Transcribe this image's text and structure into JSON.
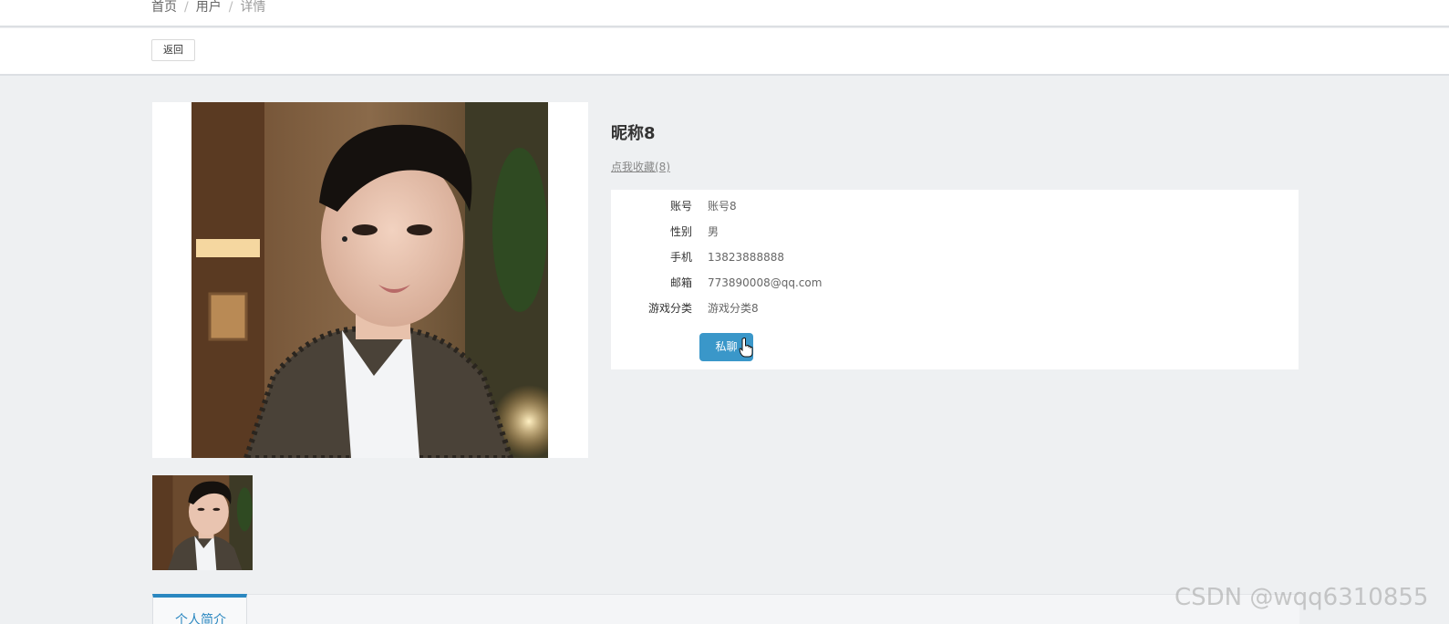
{
  "breadcrumb": {
    "home": "首页",
    "section": "用户",
    "current": "详情",
    "separator": "/"
  },
  "toolbar": {
    "back_label": "返回"
  },
  "profile": {
    "nickname": "昵称8",
    "favorite_link": "点我收藏(8)",
    "fields": [
      {
        "label": "账号",
        "value": "账号8"
      },
      {
        "label": "性别",
        "value": "男"
      },
      {
        "label": "手机",
        "value": "13823888888"
      },
      {
        "label": "邮箱",
        "value": "773890008@qq.com"
      },
      {
        "label": "游戏分类",
        "value": "游戏分类8"
      }
    ],
    "chat_label": "私聊"
  },
  "tabs": [
    {
      "label": "个人简介",
      "active": true
    }
  ],
  "watermark": "CSDN @wqq6310855",
  "colors": {
    "accent": "#3a97c9",
    "tab_accent": "#2a87c0",
    "page_bg": "#eef0f2"
  },
  "icons": {
    "cursor": "hand-pointer-icon"
  }
}
